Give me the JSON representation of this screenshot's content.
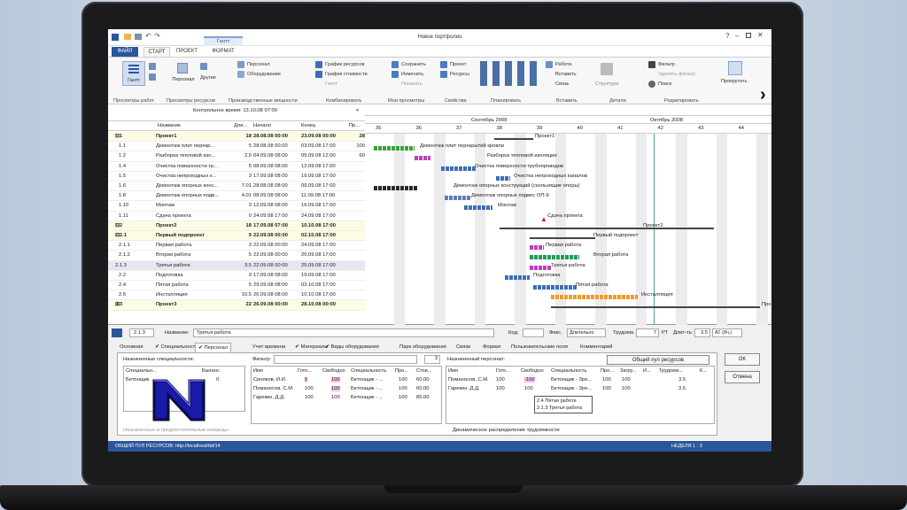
{
  "window": {
    "title": "Новое портфолио"
  },
  "ribbon": {
    "tabs": [
      "ФАЙЛ",
      "СТАРТ",
      "ПРОЕКТ",
      "ФОРМАТ"
    ],
    "context_tab": "Гантт",
    "gantt_btn": "Гантт",
    "personal_btn": "Персонал",
    "others_btn": "Другие",
    "res_items": [
      "Персонал",
      "Оборудование"
    ],
    "combi_items": [
      "График ресурсов",
      "График стоимости",
      "Гантт"
    ],
    "view_items": [
      "Сохранить",
      "Изменить",
      "Показать"
    ],
    "prop_items": [
      "Проект",
      "Ресурсы"
    ],
    "plan_labels": [
      "Работа",
      "Вставить",
      "Связь"
    ],
    "detail_label": "Структура",
    "edit_items": [
      "Фильтр",
      "Удалить фильтр",
      "Поиск"
    ],
    "scroll_label": "Прокрутить",
    "groups": [
      "Просмотры работ",
      "Просмотры ресурсов",
      "Производственные мощности",
      "Комбинировать",
      "Мои просмотры",
      "Свойства",
      "Планировать",
      "Вставить",
      "Детали",
      "Редактировать"
    ]
  },
  "table": {
    "control_time": "Контрольное время: 13.10.08 07:00",
    "headers": [
      "Название",
      "Дли...",
      "Начало",
      "Конец",
      "Пр..."
    ],
    "rows": [
      {
        "id": "⊟1",
        "name": "Проект1",
        "dur": "18",
        "start": "28.08.08 00:00",
        "end": "23.09.08 00:00",
        "pct": "28",
        "level": "sum1"
      },
      {
        "id": "1.1",
        "name": "Демонтаж плит перекр...",
        "dur": "5",
        "start": "28.08.08 00:00",
        "end": "03.09.08 17:00",
        "pct": "100",
        "level": "task"
      },
      {
        "id": "1.2",
        "name": "Разборка тепловой изо...",
        "dur": "2.5",
        "start": "04.09.08 08:00",
        "end": "05.09.08 12:00",
        "pct": "60",
        "level": "task"
      },
      {
        "id": "1.4",
        "name": "Очистка поверхности тр...",
        "dur": "5",
        "start": "08.09.08 08:00",
        "end": "12.09.08 17:00",
        "pct": "",
        "level": "task"
      },
      {
        "id": "1.5",
        "name": "Очистка непроходных к...",
        "dur": "3",
        "start": "17.09.08 08:00",
        "end": "19.09.08 17:00",
        "pct": "",
        "level": "task"
      },
      {
        "id": "1.6",
        "name": "Демонтаж опорных конс...",
        "dur": "7.01",
        "start": "28.08.08 08:00",
        "end": "09.09.08 17:00",
        "pct": "",
        "level": "task"
      },
      {
        "id": "1.8",
        "name": "Демонтаж опорных подв...",
        "dur": "4.01",
        "start": "08.09.08 08:00",
        "end": "11.09.08 17:00",
        "pct": "",
        "level": "task"
      },
      {
        "id": "1.10",
        "name": "Монтаж",
        "dur": "3",
        "start": "12.09.08 08:00",
        "end": "16.09.08 17:00",
        "pct": "",
        "level": "task"
      },
      {
        "id": "1.11",
        "name": "Сдача проекта",
        "dur": "0",
        "start": "24.09.08 17:00",
        "end": "24.09.08 17:00",
        "pct": "",
        "level": "task"
      },
      {
        "id": "⊟2",
        "name": "Проект2",
        "dur": "18",
        "start": "17.09.08 07:00",
        "end": "10.10.08 17:00",
        "pct": "",
        "level": "sum1"
      },
      {
        "id": "⊟2.1",
        "name": "Первый подпроект",
        "dur": "9",
        "start": "22.09.08 00:00",
        "end": "02.10.08 17:00",
        "pct": "",
        "level": "sum2"
      },
      {
        "id": "2.1.1",
        "name": "Первая работа",
        "dur": "3",
        "start": "22.09.08 00:00",
        "end": "24.09.08 17:00",
        "pct": "",
        "level": "task"
      },
      {
        "id": "2.1.2",
        "name": "Вторая работа",
        "dur": "5",
        "start": "22.09.08 00:00",
        "end": "26.09.08 17:00",
        "pct": "",
        "level": "task"
      },
      {
        "id": "2.1.3",
        "name": "Третья работа",
        "dur": "3.5",
        "start": "22.09.08 00:00",
        "end": "25.09.08 17:00",
        "pct": "",
        "level": "sel"
      },
      {
        "id": "2.2",
        "name": "Подготовка",
        "dur": "3",
        "start": "17.09.08 08:00",
        "end": "19.09.08 17:00",
        "pct": "",
        "level": "task"
      },
      {
        "id": "2.4",
        "name": "Пятая работа",
        "dur": "5",
        "start": "29.09.08 08:00",
        "end": "03.10.08 17:00",
        "pct": "",
        "level": "task"
      },
      {
        "id": "2.5",
        "name": "Инсталляция",
        "dur": "10.5",
        "start": "26.09.08 08:00",
        "end": "10.10.08 17:00",
        "pct": "",
        "level": "task"
      },
      {
        "id": "⊞3",
        "name": "Проект3",
        "dur": "22",
        "start": "26.09.08 00:00",
        "end": "28.10.08 00:00",
        "pct": "",
        "level": "sum1"
      }
    ]
  },
  "gantt": {
    "months": [
      "Сентябрь 2008",
      "Октябрь 2008"
    ],
    "weeks": [
      "35",
      "36",
      "37",
      "38",
      "39",
      "40",
      "41",
      "42",
      "43",
      "44"
    ],
    "labels": [
      "Проект1",
      "Демонтаж плит перекрытий кровли",
      "Разборка тепловой изоляции",
      "Очистка поверхности трубопроводов",
      "Очистка непроходных каналов",
      "Демонтаж опорных конструкций (скользящие опоры)",
      "Демонтаж опорных подвес ОП-9",
      "Монтаж",
      "Сдача проекта",
      "Проект2",
      "Первый подпроект",
      "Первая работа",
      "Вторая работа",
      "Третья работа",
      "Подготовка",
      "Пятая работа",
      "Инсталляция",
      "Про"
    ]
  },
  "form": {
    "id": "2.1.3",
    "name_label": "Название:",
    "name": "Третья работа",
    "code_label": "Код:",
    "fix_label": "Фикс.",
    "fix_value": "Длительно",
    "labor_label": "Трудоем.",
    "labor_value": "7",
    "labor_unit": "РТ",
    "dur_label": "Длит-ть:",
    "dur_value": "3.5",
    "dur_unit": "АТ (8ч.)",
    "tabs": [
      "Основная",
      "✔ Специальности",
      "✔ Персонал",
      "Учет времени",
      "✔ Материалы",
      "✔ Виды оборудования",
      "Парк оборудования",
      "Связи",
      "Формат",
      "Пользовательские поля",
      "Комментарий"
    ],
    "spec_title": "Назначенные специальности:",
    "spec_headers": [
      "Специальн...",
      "Баланс"
    ],
    "spec_rows": [
      {
        "name": "Бетонщик",
        "bal": "0"
      }
    ],
    "filter_label": "Фильтр:",
    "count": "3",
    "pool_headers": [
      "Имя",
      "Гото...",
      "Свободно",
      "Специальность",
      "Про...",
      "Стои..."
    ],
    "pool_rows": [
      {
        "name": "Синяков, И.И.",
        "ready": "0",
        "free": "100",
        "spec": "Бетонщик - ...",
        "pri": "100",
        "cost": "60.00"
      },
      {
        "name": "Поманосов, С.М.",
        "ready": "100",
        "free": "100",
        "spec": "Бетонщик - ...",
        "pri": "100",
        "cost": "60.00"
      },
      {
        "name": "Гарекин, Д.Д.",
        "ready": "100",
        "free": "100",
        "spec": "Бетонщик - ...",
        "pri": "100",
        "cost": "85.00"
      }
    ],
    "assigned_title": "Назначенный персонал:",
    "pool_button": "Общий пул ресурсов",
    "assigned_headers": [
      "Имя",
      "Гото...",
      "Свободно",
      "Специальность",
      "Про...",
      "Загру...",
      "И...",
      "Трудоем...",
      "К..."
    ],
    "assigned_rows": [
      {
        "name": "Поманосов, С.М.",
        "ready": "100",
        "free": "-100",
        "spec": "Бетонщик - Зре...",
        "pri": "100",
        "load": "100",
        "labor": "3.5"
      },
      {
        "name": "Гарекин, Д.Д.",
        "ready": "100",
        "free": "100",
        "spec": "Бетонщик - Зре...",
        "pri": "100",
        "load": "100",
        "labor": "3.5"
      }
    ],
    "tooltip": [
      "2.4 Пятая работа",
      "2.1.3 Третья работа"
    ],
    "check1": "Назначенные и предпочтительные команды",
    "check2": "Динамическое распределение трудоемкости",
    "ok": "OK",
    "cancel": "Отмена"
  },
  "status": {
    "text": "ОБЩИЙ ПУЛ РЕСУРСОВ: http://localhost/ttd/14",
    "zoom": "НЕДЕЛЯ 1 : 3"
  },
  "colors": {
    "accent": "#2b579a",
    "summary_fill": "#fdfbe3",
    "selected": "#e6e6f3"
  }
}
